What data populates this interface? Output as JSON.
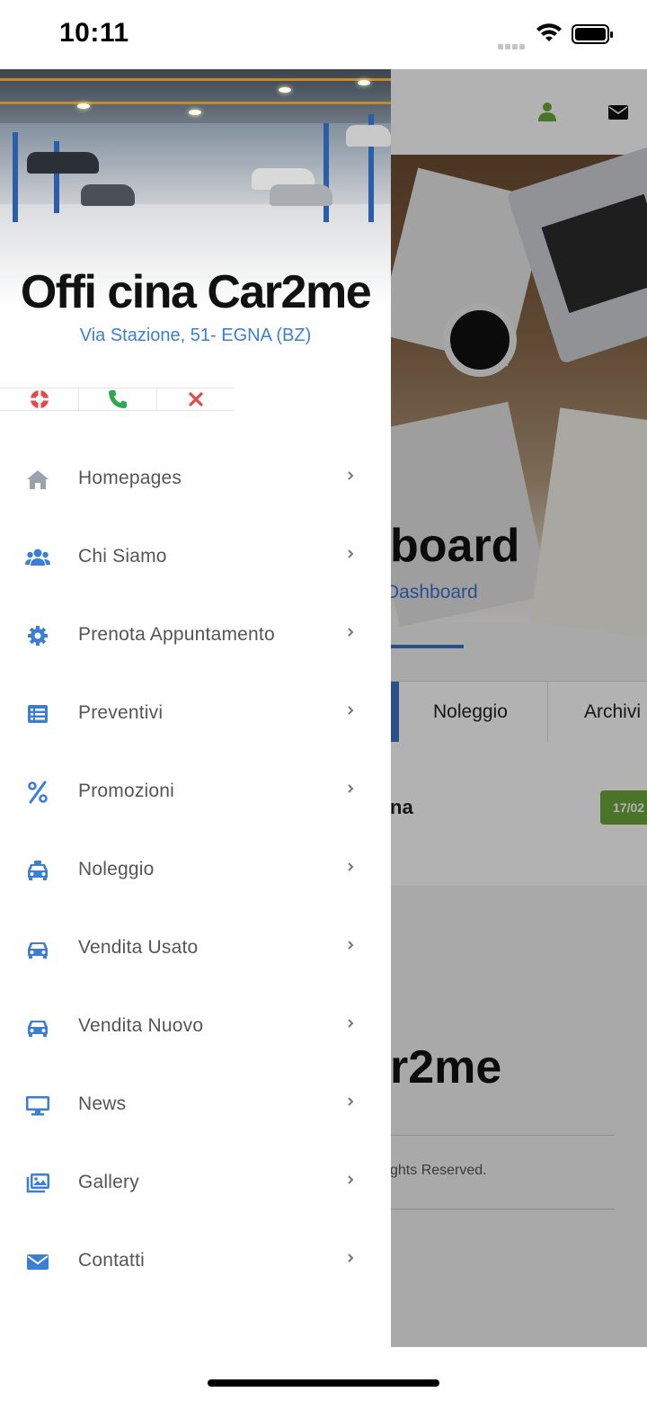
{
  "status_bar": {
    "time": "10:11"
  },
  "background_page": {
    "title_fragment": "board",
    "subtitle_fragment": "Dashboard",
    "tabs": [
      "Noleggio",
      "Archivi"
    ],
    "row_text_fragment": "na",
    "badge_fragment": "17/02",
    "footer_brand_fragment": "r2me",
    "rights_fragment": "ghts Reserved."
  },
  "drawer": {
    "brand": "Offi cina Car2me",
    "address": "Via Stazione, 51- EGNA (BZ)",
    "quick_actions": [
      "lifebuoy-icon",
      "phone-icon",
      "close-icon"
    ],
    "menu_items": [
      {
        "label": "Homepages",
        "icon": "home-icon"
      },
      {
        "label": "Chi Siamo",
        "icon": "users-icon"
      },
      {
        "label": "Prenota Appuntamento",
        "icon": "gear-icon"
      },
      {
        "label": "Preventivi",
        "icon": "list-icon"
      },
      {
        "label": "Promozioni",
        "icon": "percent-icon"
      },
      {
        "label": "Noleggio",
        "icon": "taxi-icon"
      },
      {
        "label": "Vendita Usato",
        "icon": "car-icon"
      },
      {
        "label": "Vendita Nuovo",
        "icon": "car-icon"
      },
      {
        "label": "News",
        "icon": "monitor-icon"
      },
      {
        "label": "Gallery",
        "icon": "images-icon"
      },
      {
        "label": "Contatti",
        "icon": "envelope-icon"
      }
    ]
  },
  "colors": {
    "accent_blue": "#3b7fd3",
    "icon_gray": "#9aa3ad",
    "lifebuoy_red": "#e04a4a",
    "phone_green": "#2fa84f",
    "close_red": "#e04a4a",
    "user_green": "#6aa83a",
    "badge_green": "#6aa83a"
  }
}
